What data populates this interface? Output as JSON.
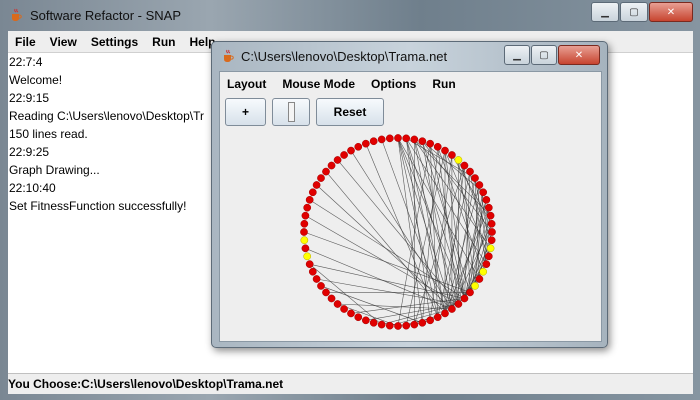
{
  "main_window": {
    "title": "Software Refactor - SNAP",
    "menu": [
      "File",
      "View",
      "Settings",
      "Run",
      "Help"
    ],
    "log_lines": [
      "22:7:4",
      "Welcome!",
      "22:9:15",
      "Reading C:\\Users\\lenovo\\Desktop\\Tr",
      "150 lines read.",
      "22:9:25",
      "Graph Drawing...",
      "22:10:40",
      "Set FitnessFunction successfully!"
    ],
    "status": "You Choose:C:\\Users\\lenovo\\Desktop\\Trama.net"
  },
  "child_window": {
    "title": "C:\\Users\\lenovo\\Desktop\\Trama.net",
    "menu": [
      "Layout",
      "Mouse Mode",
      "Options",
      "Run"
    ],
    "toolbar": {
      "zoom_in": "+",
      "reset": "Reset"
    }
  },
  "graph": {
    "node_count": 72,
    "colors": {
      "default_node": "#e00000",
      "highlight_node": "#ffff00",
      "edge": "#333333"
    },
    "highlighted_nodes": [
      8,
      20,
      23,
      25,
      51,
      53
    ],
    "edges": [
      [
        0,
        27
      ],
      [
        0,
        29
      ],
      [
        0,
        31
      ],
      [
        0,
        33
      ],
      [
        1,
        28
      ],
      [
        1,
        30
      ],
      [
        1,
        32
      ],
      [
        2,
        27
      ],
      [
        2,
        30
      ],
      [
        2,
        34
      ],
      [
        3,
        26
      ],
      [
        3,
        29
      ],
      [
        4,
        27
      ],
      [
        4,
        31
      ],
      [
        5,
        28
      ],
      [
        5,
        33
      ],
      [
        6,
        27
      ],
      [
        6,
        30
      ],
      [
        7,
        29
      ],
      [
        7,
        32
      ],
      [
        8,
        25
      ],
      [
        8,
        28
      ],
      [
        9,
        26
      ],
      [
        9,
        30
      ],
      [
        10,
        27
      ],
      [
        10,
        31
      ],
      [
        11,
        24
      ],
      [
        11,
        29
      ],
      [
        12,
        26
      ],
      [
        12,
        30
      ],
      [
        13,
        25
      ],
      [
        13,
        28
      ],
      [
        14,
        27
      ],
      [
        14,
        29
      ],
      [
        15,
        26
      ],
      [
        15,
        30
      ],
      [
        16,
        27
      ],
      [
        17,
        26
      ],
      [
        17,
        29
      ],
      [
        18,
        25
      ],
      [
        19,
        27
      ],
      [
        20,
        26
      ],
      [
        21,
        28
      ],
      [
        22,
        27
      ],
      [
        23,
        28
      ],
      [
        24,
        26
      ],
      [
        40,
        28
      ],
      [
        42,
        27
      ],
      [
        44,
        29
      ],
      [
        46,
        26
      ],
      [
        48,
        28
      ],
      [
        50,
        27
      ],
      [
        52,
        29
      ],
      [
        54,
        26
      ],
      [
        56,
        28
      ],
      [
        58,
        27
      ],
      [
        60,
        29
      ],
      [
        62,
        30
      ],
      [
        64,
        28
      ],
      [
        66,
        29
      ],
      [
        68,
        31
      ],
      [
        70,
        30
      ],
      [
        0,
        24
      ],
      [
        1,
        22
      ],
      [
        2,
        20
      ],
      [
        3,
        18
      ],
      [
        5,
        23
      ],
      [
        6,
        21
      ],
      [
        8,
        19
      ],
      [
        10,
        22
      ],
      [
        12,
        20
      ],
      [
        30,
        35
      ],
      [
        31,
        36
      ],
      [
        32,
        34
      ],
      [
        29,
        37
      ],
      [
        28,
        38
      ],
      [
        4,
        36
      ],
      [
        6,
        35
      ],
      [
        9,
        34
      ],
      [
        36,
        44
      ],
      [
        38,
        50
      ],
      [
        33,
        47
      ],
      [
        3,
        13
      ],
      [
        1,
        11
      ],
      [
        7,
        17
      ],
      [
        15,
        23
      ],
      [
        2,
        16
      ],
      [
        11,
        21
      ]
    ]
  }
}
